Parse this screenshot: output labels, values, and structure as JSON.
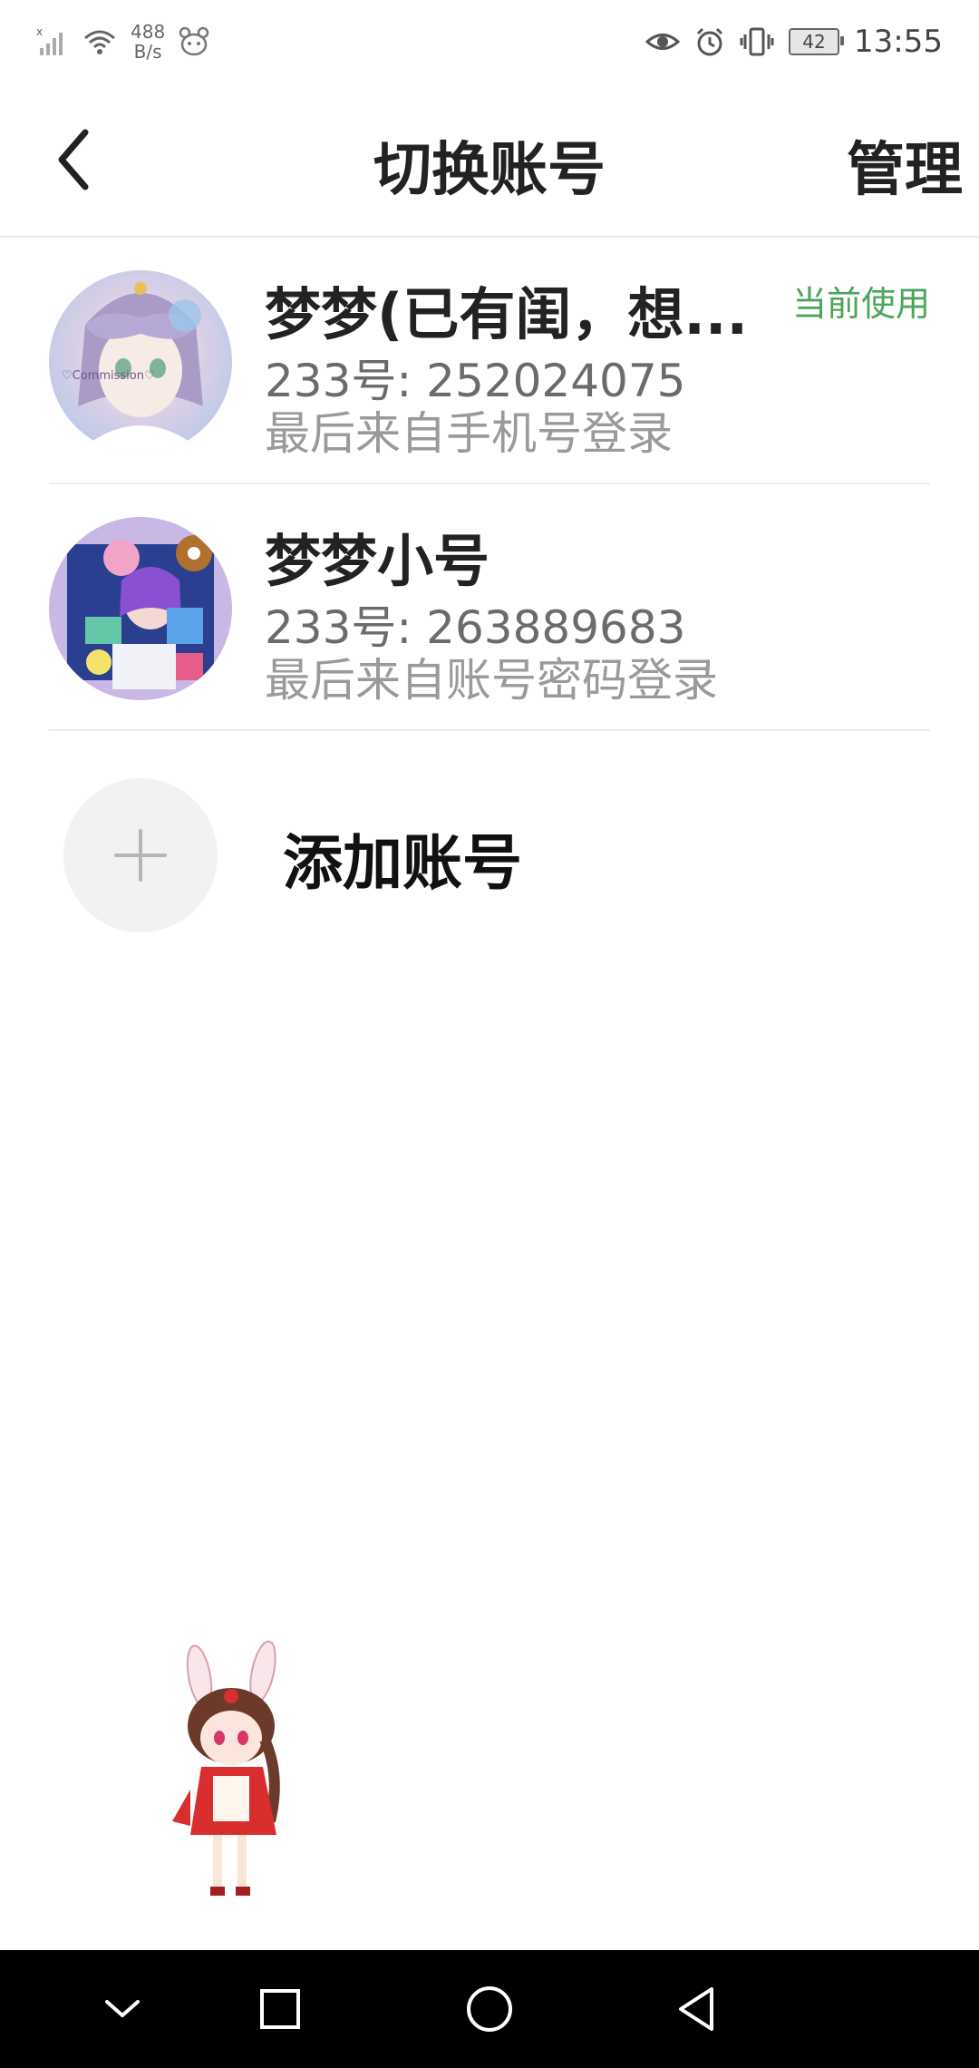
{
  "status_bar": {
    "net_speed_value": "488",
    "net_speed_unit": "B/s",
    "battery": "42",
    "time": "13:55",
    "icons": [
      "signal-icon",
      "wifi-icon",
      "app-notification-icon",
      "eye-icon",
      "alarm-icon",
      "vibrate-icon",
      "battery-icon"
    ]
  },
  "header": {
    "title": "切换账号",
    "manage_label": "管理"
  },
  "accounts": [
    {
      "name": "梦梦(已有闺，想...",
      "id_line": "233号: 252024075",
      "login_line": "最后来自手机号登录",
      "badge": "当前使用",
      "avatar_watermark": "♡Commission♡"
    },
    {
      "name": "梦梦小号",
      "id_line": "233号: 263889683",
      "login_line": "最后来自账号密码登录"
    }
  ],
  "add_account": {
    "label": "添加账号"
  },
  "colors": {
    "accent_green": "#4aa55a",
    "nav_bar": "#000000"
  },
  "nav_bar": {
    "icons": [
      "hide-nav-icon",
      "recent-apps-icon",
      "home-icon",
      "back-nav-icon"
    ]
  }
}
